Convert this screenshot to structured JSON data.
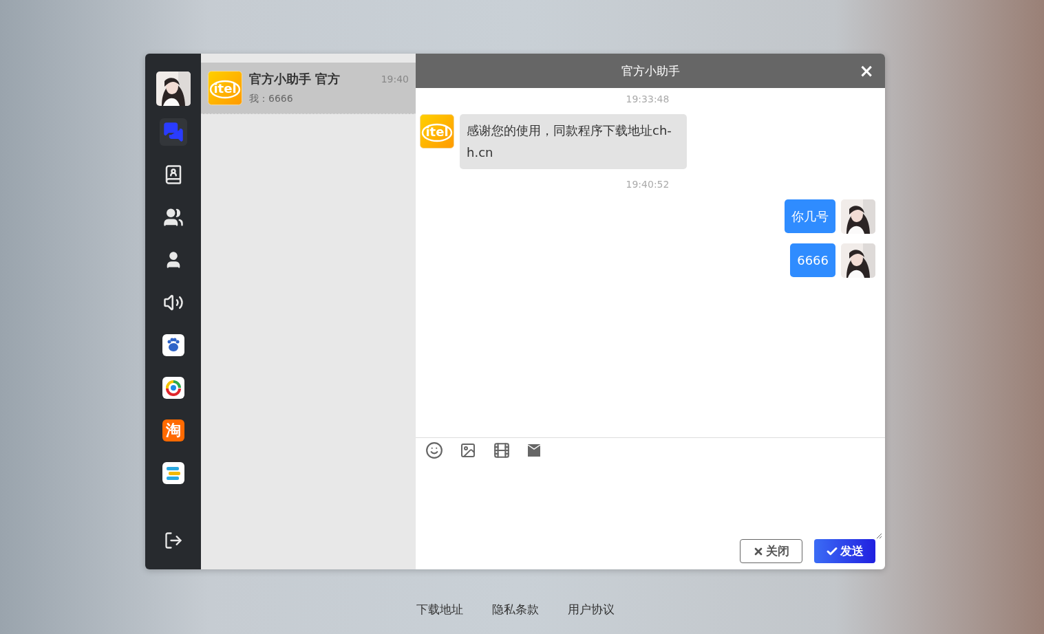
{
  "sidebar": {
    "items": [
      {
        "kind": "chat",
        "selected": true
      },
      {
        "kind": "contacts",
        "selected": false
      },
      {
        "kind": "groups",
        "selected": false
      },
      {
        "kind": "user",
        "selected": false
      },
      {
        "kind": "speaker",
        "selected": false
      },
      {
        "kind": "paw",
        "selected": false
      },
      {
        "kind": "ring",
        "selected": false
      },
      {
        "kind": "tao",
        "glyph": "淘",
        "selected": false
      },
      {
        "kind": "stripes",
        "selected": false
      }
    ]
  },
  "conversations": [
    {
      "logo_text": "itel",
      "name": "官方小助手 官方",
      "time": "19:40",
      "preview": "我：6666",
      "selected": true
    }
  ],
  "chat": {
    "title": "官方小助手",
    "close": "×",
    "messages": [
      {
        "kind": "time",
        "text": "19:33:48"
      },
      {
        "kind": "in",
        "logo_text": "itel",
        "text": "感谢您的使用，同款程序下载地址ch-h.cn"
      },
      {
        "kind": "time",
        "text": "19:40:52"
      },
      {
        "kind": "out",
        "text": "你几号"
      },
      {
        "kind": "out",
        "text": "6666"
      }
    ],
    "buttons": [
      {
        "kind": "close",
        "label": "关闭"
      },
      {
        "kind": "send",
        "label": "发送"
      }
    ]
  },
  "footer_links": [
    "下载地址",
    "隐私条款",
    "用户协议"
  ]
}
